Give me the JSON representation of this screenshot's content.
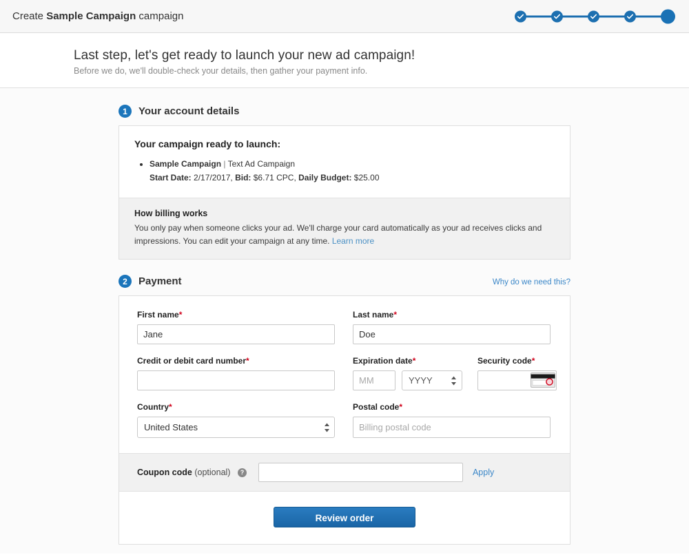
{
  "topbar": {
    "title_prefix": "Create ",
    "title_bold": "Sample Campaign",
    "title_suffix": " campaign",
    "progress": {
      "steps": [
        {
          "state": "complete",
          "icon": "check-icon"
        },
        {
          "state": "complete",
          "icon": "check-icon"
        },
        {
          "state": "complete",
          "icon": "check-icon"
        },
        {
          "state": "complete",
          "icon": "check-icon"
        },
        {
          "state": "current",
          "icon": "filled-dot-icon"
        }
      ],
      "accent_color": "#1c6fb0"
    }
  },
  "hero": {
    "heading": "Last step, let's get ready to launch your new ad campaign!",
    "subheading": "Before we do, we'll double-check your details, then gather your payment info."
  },
  "section1": {
    "number": "1",
    "title": "Your account details",
    "card_heading": "Your campaign ready to launch:",
    "campaign_name": "Sample Campaign",
    "campaign_separator": "|",
    "campaign_type": "Text Ad Campaign",
    "detail_line": {
      "start_date_label": "Start Date:",
      "start_date_value": " 2/17/2017, ",
      "bid_label": "Bid:",
      "bid_value": " $6.71 CPC, ",
      "budget_label": "Daily Budget:",
      "budget_value": " $25.00"
    },
    "billing": {
      "heading": "How billing works",
      "body": "You only pay when someone clicks your ad. We'll charge your card automatically as your ad receives clicks and impressions. You can edit your campaign at any time. ",
      "link": "Learn more"
    }
  },
  "section2": {
    "number": "2",
    "title": "Payment",
    "help_link": "Why do we need this?",
    "required_mark": "*",
    "fields": {
      "first_name": {
        "label": "First name",
        "value": "Jane",
        "placeholder": ""
      },
      "last_name": {
        "label": "Last name",
        "value": "Doe",
        "placeholder": ""
      },
      "card_number": {
        "label": "Credit or debit card number",
        "value": "",
        "placeholder": ""
      },
      "expiration": {
        "label": "Expiration date",
        "month_placeholder": "MM",
        "month_value": "",
        "year_value": "YYYY"
      },
      "security_code": {
        "label": "Security code",
        "value": "",
        "placeholder": "",
        "icon": "cvv-card-icon"
      },
      "country": {
        "label": "Country",
        "value": "United States"
      },
      "postal_code": {
        "label": "Postal code",
        "value": "",
        "placeholder": "Billing postal code"
      }
    },
    "coupon": {
      "label": "Coupon code",
      "optional": "(optional)",
      "help_icon": "question-mark-icon",
      "value": "",
      "placeholder": "",
      "apply_label": "Apply"
    },
    "submit_label": "Review order"
  },
  "colors": {
    "accent_blue": "#1b75bb",
    "link_blue": "#3b87c8",
    "required_red": "#d0021b",
    "panel_gray": "#f1f1f1",
    "button_blue": "#1f6fb2"
  }
}
